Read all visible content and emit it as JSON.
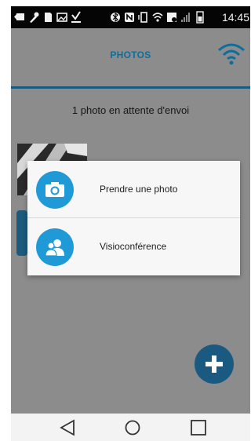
{
  "status_bar": {
    "time": "14:45",
    "icons": [
      "back-arrow-icon",
      "wrench-icon",
      "sd-card-icon",
      "image-icon",
      "download-icon",
      "bluetooth-icon",
      "nfc-icon",
      "vibrate-icon",
      "wifi-icon",
      "no-sim-icon",
      "signal-icon",
      "battery-icon"
    ]
  },
  "app_bar": {
    "title": "PHOTOS",
    "title_color": "#0f6d9c",
    "wifi_icon": "wifi-icon",
    "wifi_color": "#0f6d9c"
  },
  "content": {
    "pending_text": "1 photo en attente d'envoi",
    "fab_icon": "plus-icon"
  },
  "dialog": {
    "items": [
      {
        "label": "Prendre une photo",
        "icon": "camera-icon"
      },
      {
        "label": "Visioconférence",
        "icon": "video-call-icon"
      }
    ],
    "accent": "#1f9ad6"
  },
  "nav_bar": {
    "buttons": [
      "back-icon",
      "home-icon",
      "recents-icon"
    ]
  }
}
